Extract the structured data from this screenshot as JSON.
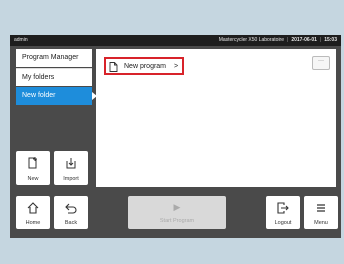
{
  "status_bar": {
    "user": "admin",
    "device_name": "Mastercycler X50 Laboratoire",
    "date": "2017-06-01",
    "time": "15:03"
  },
  "sidebar": {
    "items": [
      {
        "label": "Program Manager"
      },
      {
        "label": "My folders"
      },
      {
        "label": "New folder"
      }
    ]
  },
  "side_buttons": {
    "new_label": "New",
    "import_label": "Import"
  },
  "main": {
    "program_name": "New program",
    "program_chevron": ">",
    "more_label": "···"
  },
  "bottom_bar": {
    "home_label": "Home",
    "back_label": "Back",
    "start_label": "Start Program",
    "logout_label": "Logout",
    "menu_label": "Menu"
  },
  "colors": {
    "accent": "#1e8ddb",
    "highlight_border": "#d8232a"
  },
  "icons": {
    "new": "new-document-icon",
    "import": "import-icon",
    "home": "home-icon",
    "back": "back-arrow-icon",
    "start": "play-icon",
    "logout": "logout-icon",
    "menu": "hamburger-menu-icon",
    "program": "document-icon"
  }
}
